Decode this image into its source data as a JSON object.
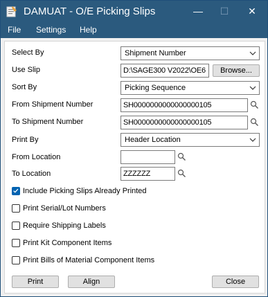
{
  "window": {
    "title": "DAMUAT - O/E Picking Slips",
    "controls": {
      "minimize": "—",
      "maximize": "☐",
      "close": "✕"
    }
  },
  "menu": {
    "items": [
      "File",
      "Settings",
      "Help"
    ]
  },
  "form": {
    "select_by": {
      "label": "Select By",
      "value": "Shipment Number"
    },
    "use_slip": {
      "label": "Use Slip",
      "value": "D:\\SAGE300 V2022\\OE6",
      "browse_label": "Browse..."
    },
    "sort_by": {
      "label": "Sort By",
      "value": "Picking Sequence"
    },
    "from_shipment": {
      "label": "From Shipment Number",
      "value": "SH0000000000000000105"
    },
    "to_shipment": {
      "label": "To Shipment Number",
      "value": "SH0000000000000000105"
    },
    "print_by": {
      "label": "Print By",
      "value": "Header Location"
    },
    "from_location": {
      "label": "From Location",
      "value": ""
    },
    "to_location": {
      "label": "To Location",
      "value": "ZZZZZZ"
    },
    "checkboxes": [
      {
        "label": "Include Picking Slips Already Printed",
        "checked": true
      },
      {
        "label": "Print Serial/Lot Numbers",
        "checked": false
      },
      {
        "label": "Require Shipping Labels",
        "checked": false
      },
      {
        "label": "Print Kit Component Items",
        "checked": false
      },
      {
        "label": "Print Bills of Material Component Items",
        "checked": false
      }
    ]
  },
  "buttons": {
    "print": "Print",
    "align": "Align",
    "close": "Close"
  }
}
